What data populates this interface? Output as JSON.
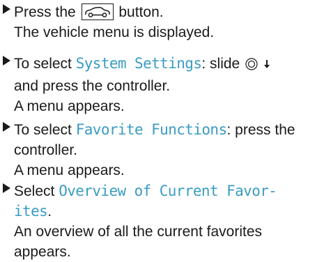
{
  "steps": [
    {
      "lines": {
        "l1_a": "Press the ",
        "l1_b": " button.",
        "l2": "The vehicle menu is displayed."
      }
    },
    {
      "lines": {
        "l1_a": "To select ",
        "l1_term": "System Settings",
        "l1_b": ": slide ",
        "l2": "and press the controller.",
        "l3": "A menu appears."
      }
    },
    {
      "lines": {
        "l1_a": "To select ",
        "l1_term": "Favorite Functions",
        "l1_b": ": press the",
        "l2": "controller.",
        "l3": "A menu appears."
      }
    },
    {
      "lines": {
        "l1_a": "Select ",
        "l1_term": "Overview of Current Favor-",
        "l2_term": "ites",
        "l2_b": ".",
        "l3": "An overview of all the current favorites",
        "l4": "appears."
      }
    }
  ],
  "icons": {
    "step_marker": "right-triangle-icon",
    "vehicle_button": "car-icon",
    "controller": "controller-icon",
    "slide_direction": "arrow-down-icon"
  },
  "colors": {
    "menu_term": "#3a9cc2",
    "text": "#1a1a1a"
  }
}
